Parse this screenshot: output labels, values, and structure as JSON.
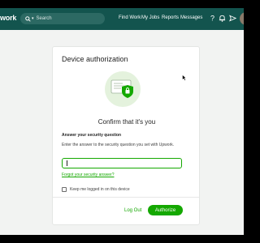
{
  "header": {
    "logo": "work",
    "search_placeholder": "Search",
    "nav": [
      "Find Work",
      "My Jobs",
      "Reports",
      "Messages"
    ],
    "icons": [
      "help-icon",
      "bell-icon",
      "send-icon",
      "avatar"
    ]
  },
  "dialog": {
    "title": "Device authorization",
    "subtitle": "Confirm that it's you",
    "security_label": "Answer your security question",
    "security_help": "Enter the answer to the security question you set with Upwork.",
    "answer_value": "",
    "forgot_link": "Forgot your security answer?",
    "keep_logged_in": "Keep me logged in on this device",
    "logout_label": "Log Out",
    "authorize_label": "Authorize"
  },
  "colors": {
    "header_bg": "#13544e",
    "accent": "#14a800",
    "page_bg": "#f2f3f2"
  }
}
